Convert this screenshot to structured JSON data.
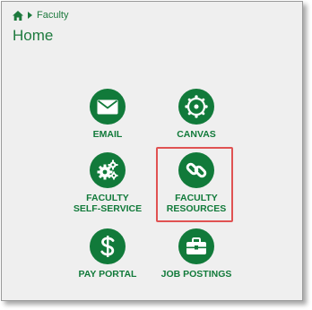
{
  "breadcrumb": {
    "home_icon": "home-icon",
    "separator_icon": "caret-right-icon",
    "current": "Faculty"
  },
  "page": {
    "title": "Home"
  },
  "tiles": [
    {
      "label_1": "EMAIL",
      "label_2": "",
      "icon": "envelope-icon"
    },
    {
      "label_1": "CANVAS",
      "label_2": "",
      "icon": "canvas-icon"
    },
    {
      "label_1": "FACULTY",
      "label_2": "SELF-SERVICE",
      "icon": "gears-icon"
    },
    {
      "label_1": "FACULTY",
      "label_2": "RESOURCES",
      "icon": "chain-link-icon",
      "highlighted": true
    },
    {
      "label_1": "PAY PORTAL",
      "label_2": "",
      "icon": "dollar-icon"
    },
    {
      "label_1": "JOB POSTINGS",
      "label_2": "",
      "icon": "briefcase-icon"
    }
  ],
  "colors": {
    "accent": "#117a3a",
    "highlight": "#e05252",
    "background": "#efefef"
  }
}
